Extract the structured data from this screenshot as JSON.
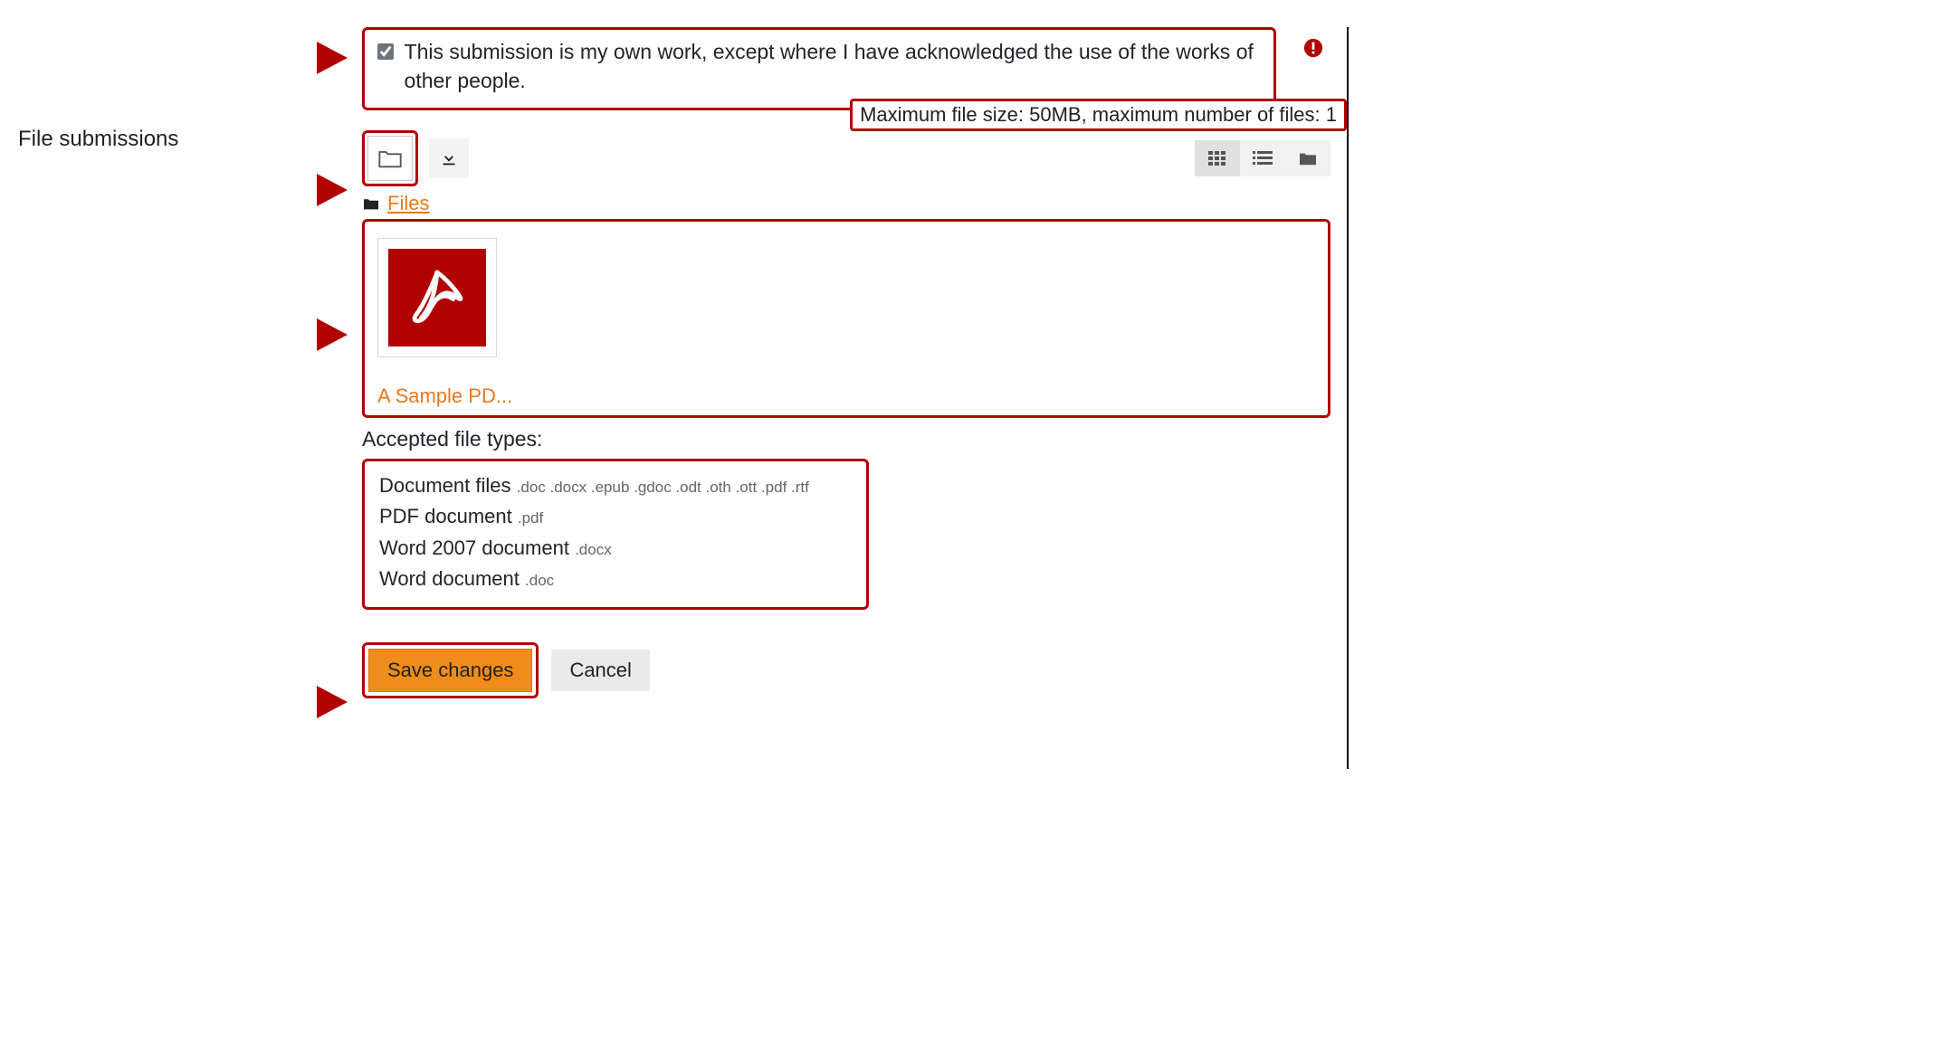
{
  "declaration": {
    "text": "This submission is my own work, except where I have acknowledged the use of the works of other people.",
    "checked": true,
    "required": true
  },
  "section_label": "File submissions",
  "limits_text": "Maximum file size: 50MB, maximum number of files: 1",
  "breadcrumb": {
    "label": "Files"
  },
  "file": {
    "name": "A Sample PD...",
    "type": "pdf"
  },
  "accepted_label": "Accepted file types:",
  "accepted_types": [
    {
      "label": "Document files",
      "ext": ".doc .docx .epub .gdoc .odt .oth .ott .pdf .rtf"
    },
    {
      "label": "PDF document",
      "ext": ".pdf"
    },
    {
      "label": "Word 2007 document",
      "ext": ".docx"
    },
    {
      "label": "Word document",
      "ext": ".doc"
    }
  ],
  "buttons": {
    "save": "Save changes",
    "cancel": "Cancel"
  }
}
